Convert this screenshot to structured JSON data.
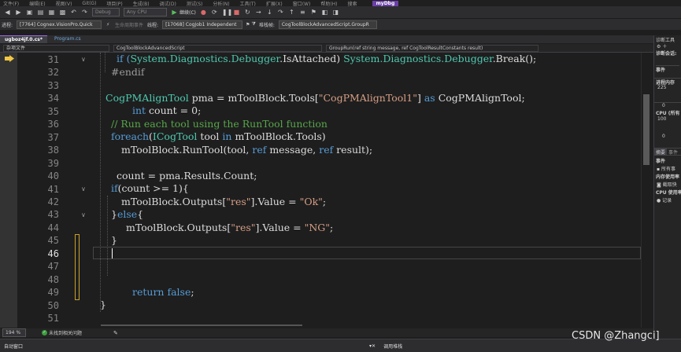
{
  "menubar": {
    "items": [
      "文件(F)",
      "编辑(E)",
      "视图(V)",
      "Git(G)",
      "项目(P)",
      "生成(B)",
      "调试(D)",
      "测试(S)",
      "分析(N)",
      "工具(T)",
      "扩展(X)",
      "窗口(W)",
      "帮助(H)"
    ],
    "search": "搜索",
    "title": "myDbg"
  },
  "toolbar": {
    "config": "Debug",
    "platform": "Any CPU",
    "continue_label": "继续(C)"
  },
  "debugbar": {
    "process_label": "进程:",
    "process": "[7764] Cognex.VisionPro.Quick",
    "lifecycle_label": "生命周期事件",
    "thread_label": "线程:",
    "thread": "[17068] CogJob1 Independent",
    "stack_label": "堆栈帧:",
    "stack": "CogToolBlockAdvancedScript.GroupR"
  },
  "tabs": [
    {
      "label": "ugboz4jf.0.cs*",
      "active": true
    },
    {
      "label": "Program.cs",
      "active": false
    }
  ],
  "navbar": {
    "scope": "杂项文件",
    "class": "CogToolBlockAdvancedScript",
    "method": "GroupRun(ref string message, ref CogToolResultConstants result)"
  },
  "line_numbers": [
    "31",
    "32",
    "33",
    "34",
    "35",
    "36",
    "37",
    "38",
    "39",
    "40",
    "41",
    "42",
    "43",
    "44",
    "45",
    "46",
    "47",
    "48",
    "49",
    "50",
    "51"
  ],
  "current_line": "46",
  "code": {
    "l31a": "if (",
    "l31b": "System.Diagnostics.Debugger",
    "l31c": ".IsAttached) ",
    "l31d": "System.Diagnostics.Debugger",
    "l31e": ".Break();",
    "l32": "#endif",
    "l34a": "CogPMAlignTool",
    "l34b": " pma = mToolBlock.Tools[",
    "l34c": "\"CogPMAlignTool1\"",
    "l34d": "] ",
    "l34e": "as",
    "l34f": " CogPMAlignTool;",
    "l35a": "int",
    "l35b": " count = 0;",
    "l36": "// Run each tool using the RunTool function",
    "l37a": "foreach",
    "l37b": "(",
    "l37c": "ICogTool",
    "l37d": " tool ",
    "l37e": "in",
    "l37f": " mToolBlock.Tools)",
    "l38a": "mToolBlock.RunTool(tool, ",
    "l38b": "ref",
    "l38c": " message, ",
    "l38d": "ref",
    "l38e": " result);",
    "l40": "count = pma.Results.Count;",
    "l41a": "if",
    "l41b": "(count >= 1){",
    "l42a": "mToolBlock.Outputs[",
    "l42b": "\"res\"",
    "l42c": "].Value = ",
    "l42d": "\"Ok\"",
    "l42e": ";",
    "l43a": "}",
    "l43b": "else",
    "l43c": "{",
    "l44a": "mToolBlock.Outputs[",
    "l44b": "\"res\"",
    "l44c": "].Value = ",
    "l44d": "\"NG\"",
    "l44e": ";",
    "l45": "}",
    "l49a": "return",
    "l49b": " ",
    "l49c": "false",
    "l49d": ";",
    "l50": "}"
  },
  "status": {
    "zoom": "194 %",
    "issues": "未找到相关问题"
  },
  "bottom": {
    "left_pane": "自动窗口",
    "right_pane": "调用堆栈"
  },
  "diag": {
    "title": "诊断工具",
    "session": "诊断会话:",
    "events": "事件",
    "process_memory": "进程内存",
    "mem_max": "225",
    "mem_min": "0",
    "cpu": "CPU (所有",
    "cpu_max": "100",
    "cpu_min": "0",
    "tab_summary": "摘要",
    "tab_events": "事件",
    "ev_header": "事件",
    "ev_all": "所有事",
    "mem_usage": "内存使用率",
    "snapshot": "截取快",
    "cpu_usage": "CPU 使用率",
    "record": "记录"
  },
  "watermark": "CSDN @Zhangci]",
  "colors": {
    "keyword": "#569cd6",
    "type": "#4ec9b0",
    "string": "#d69d85",
    "comment": "#57a64a",
    "accent": "#6a3fa8"
  }
}
